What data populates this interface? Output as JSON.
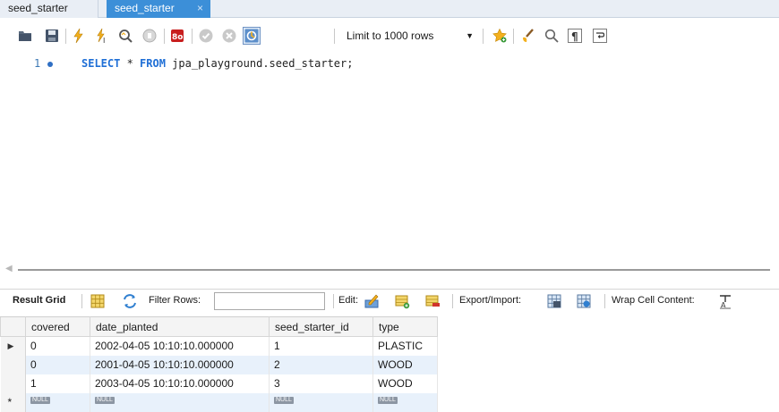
{
  "tabs": [
    {
      "label": "seed_starter",
      "active": false
    },
    {
      "label": "seed_starter",
      "active": true,
      "close_glyph": "×"
    }
  ],
  "toolbar": {
    "icons": [
      "open-folder-icon",
      "save-icon",
      "execute-lightning-icon",
      "execute-statement-icon",
      "explain-magnifier-icon",
      "stop-icon",
      "toggle-error-icon",
      "commit-icon",
      "rollback-icon",
      "autocommit-icon"
    ],
    "limit_label": "Limit to 1000 rows",
    "right_icons": [
      "bookmark-star-icon",
      "beautify-brush-icon",
      "find-magnifier-icon",
      "invisible-chars-icon",
      "word-wrap-icon"
    ]
  },
  "editor": {
    "line_number": "1",
    "sql": {
      "kw1": "SELECT",
      "star": " * ",
      "kw2": "FROM",
      "rest": " jpa_playground.seed_starter;"
    }
  },
  "result_toolbar": {
    "result_grid_label": "Result Grid",
    "filter_label": "Filter Rows:",
    "filter_value": "",
    "edit_label": "Edit:",
    "export_label": "Export/Import:",
    "wrap_label": "Wrap Cell Content:"
  },
  "grid": {
    "columns": [
      "covered",
      "date_planted",
      "seed_starter_id",
      "type"
    ],
    "rows": [
      {
        "marker": "▶",
        "covered": "0",
        "date_planted": "2002-04-05 10:10:10.000000",
        "seed_starter_id": "1",
        "type": "PLASTIC"
      },
      {
        "marker": "",
        "covered": "0",
        "date_planted": "2001-04-05 10:10:10.000000",
        "seed_starter_id": "2",
        "type": "WOOD"
      },
      {
        "marker": "",
        "covered": "1",
        "date_planted": "2003-04-05 10:10:10.000000",
        "seed_starter_id": "3",
        "type": "WOOD"
      }
    ],
    "new_row": {
      "marker": "*",
      "null_label": "NULL"
    }
  },
  "colors": {
    "accent": "#3c8fd8",
    "keyword": "#1f6fd6",
    "alt_row": "#e8f1fb"
  }
}
